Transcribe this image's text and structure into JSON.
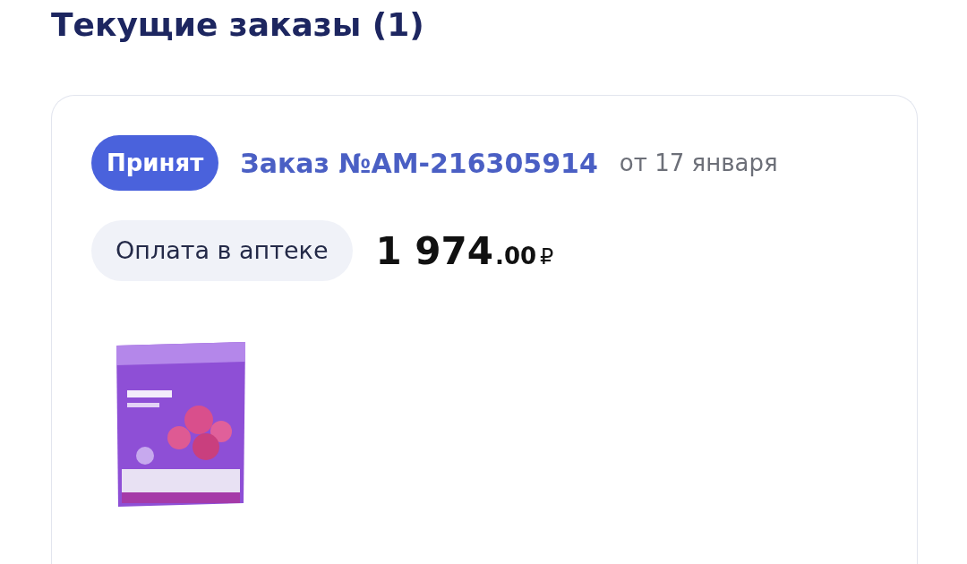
{
  "title": "Текущие заказы (1)",
  "order": {
    "status": {
      "label": "Принят",
      "kind": "accepted"
    },
    "number": "Заказ №АМ-216305914",
    "date": "от 17 января",
    "payment": "Оплата в аптеке",
    "price": {
      "main": "1 974",
      "fraction": ".00",
      "currency": "₽"
    }
  }
}
